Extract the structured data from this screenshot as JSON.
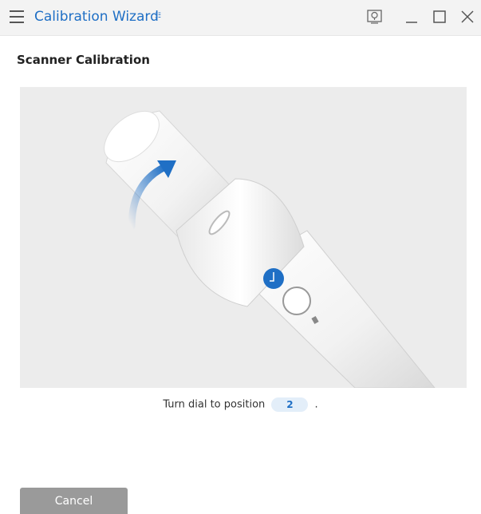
{
  "window": {
    "title": "Calibration Wizard",
    "title_badge": "☷",
    "buttons": [
      "help-icon",
      "minimize-icon",
      "maximize-icon",
      "close-icon"
    ]
  },
  "page": {
    "heading": "Scanner Calibration"
  },
  "illustration": {
    "subject": "scanner handpiece with rotating dial",
    "dial_marker": "⌒"
  },
  "instruction": {
    "prefix": "Turn dial to position",
    "position_value": "2",
    "suffix": "."
  },
  "footer": {
    "cancel_label": "Cancel"
  },
  "colors": {
    "accent": "#1f6fc5",
    "titlebar_bg": "#f3f3f3",
    "illustration_bg": "#ececec",
    "cancel_bg": "#9a9a9a"
  }
}
